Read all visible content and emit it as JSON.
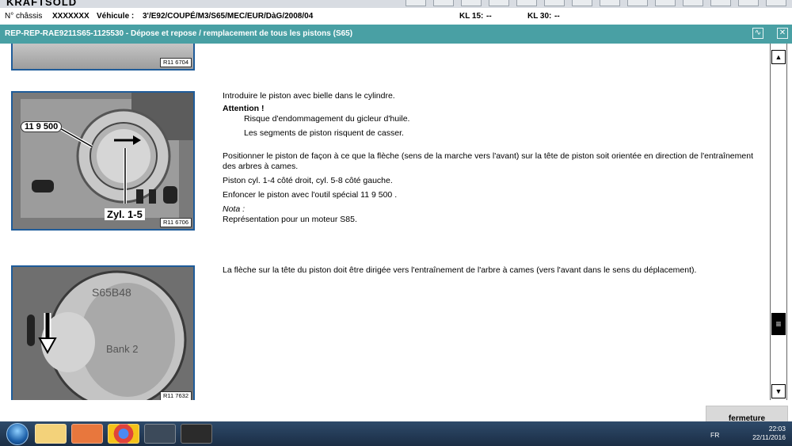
{
  "app": {
    "brand": "KRAFTSOLD"
  },
  "vehicle": {
    "chassis_label": "N° châssis",
    "chassis_value": "XXXXXXX",
    "vehicle_label": "Véhicule :",
    "vehicle_value": "3'/E92/COUPÉ/M3/S65/MEC/EUR/DàG/2008/04",
    "kl15_label": "KL 15:",
    "kl15_value": "--",
    "kl30_label": "KL 30:",
    "kl30_value": "--"
  },
  "title": {
    "text": "REP-REP-RAE9211S65-1125530  -  Dépose et repose / remplacement de tous les pistons (S65)"
  },
  "images": [
    {
      "ref": "R11 6704"
    },
    {
      "ref": "R11 6706",
      "tool_callout": "11 9 500",
      "cyl_callout": "Zyl. 1-5"
    },
    {
      "ref": "R11 7632",
      "stamp_text": "S65B48",
      "bank_text": "Bank 2"
    }
  ],
  "step1": {
    "intro": "Introduire le piston avec bielle dans le cylindre.",
    "attention_title": "Attention !",
    "attention_1": "Risque d'endommagement du gicleur d'huile.",
    "attention_2": "Les segments de piston risquent de casser.",
    "position": "Positionner le piston de façon à ce que la flèche (sens de la marche vers l'avant) sur la tête de piston soit orientée en direction de l'entraînement des arbres à cames.",
    "sides": "Piston cyl. 1-4 côté droit, cyl. 5-8 côté gauche.",
    "press": "Enfoncer le piston avec l'outil spécial 11 9 500 .",
    "nota_label": "Nota :",
    "nota_text": "Représentation pour un moteur S85."
  },
  "step2": {
    "text": "La flèche sur la tête du piston doit être dirigée vers l'entraînement de l'arbre à cames (vers l'avant dans le sens du déplacement)."
  },
  "buttons": {
    "close_label": "fermeture"
  },
  "taskbar": {
    "lang": "FR",
    "time": "22:03",
    "date": "22/11/2016"
  }
}
